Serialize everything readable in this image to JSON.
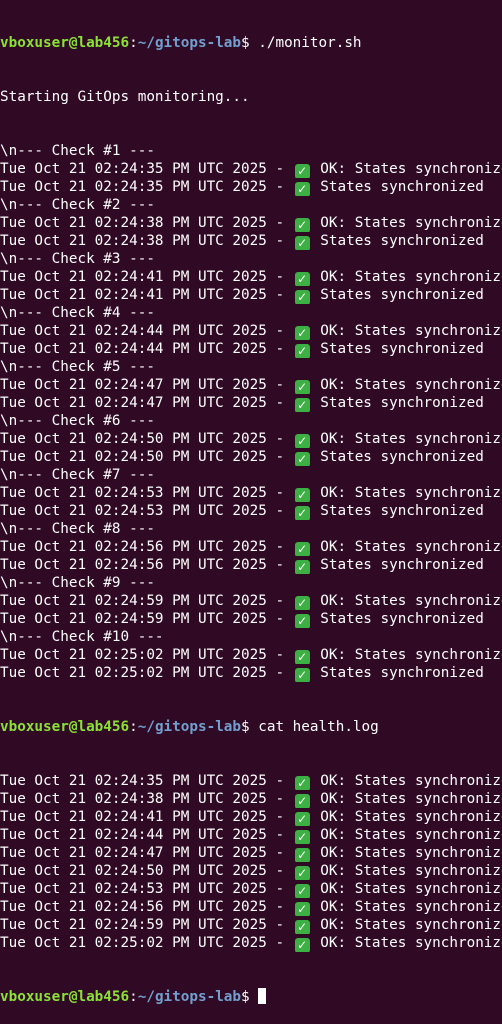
{
  "prompt": {
    "user_host": "vboxuser@lab456",
    "separator": ":",
    "path": "~/gitops-lab",
    "symbol": "$ "
  },
  "commands": {
    "first": "./monitor.sh",
    "second": "cat health.log"
  },
  "monitor_start": "Starting GitOps monitoring...",
  "check_icon_glyph": "✓",
  "checks": [
    {
      "header": "\\n--- Check #1 ---",
      "lines": [
        {
          "prefix": "Tue Oct 21 02:24:35 PM UTC 2025 - ",
          "msg": " OK: States synchronized"
        },
        {
          "prefix": "Tue Oct 21 02:24:35 PM UTC 2025 - ",
          "msg": " States synchronized"
        }
      ]
    },
    {
      "header": "\\n--- Check #2 ---",
      "lines": [
        {
          "prefix": "Tue Oct 21 02:24:38 PM UTC 2025 - ",
          "msg": " OK: States synchronized"
        },
        {
          "prefix": "Tue Oct 21 02:24:38 PM UTC 2025 - ",
          "msg": " States synchronized"
        }
      ]
    },
    {
      "header": "\\n--- Check #3 ---",
      "lines": [
        {
          "prefix": "Tue Oct 21 02:24:41 PM UTC 2025 - ",
          "msg": " OK: States synchronized"
        },
        {
          "prefix": "Tue Oct 21 02:24:41 PM UTC 2025 - ",
          "msg": " States synchronized"
        }
      ]
    },
    {
      "header": "\\n--- Check #4 ---",
      "lines": [
        {
          "prefix": "Tue Oct 21 02:24:44 PM UTC 2025 - ",
          "msg": " OK: States synchronized"
        },
        {
          "prefix": "Tue Oct 21 02:24:44 PM UTC 2025 - ",
          "msg": " States synchronized"
        }
      ]
    },
    {
      "header": "\\n--- Check #5 ---",
      "lines": [
        {
          "prefix": "Tue Oct 21 02:24:47 PM UTC 2025 - ",
          "msg": " OK: States synchronized"
        },
        {
          "prefix": "Tue Oct 21 02:24:47 PM UTC 2025 - ",
          "msg": " States synchronized"
        }
      ]
    },
    {
      "header": "\\n--- Check #6 ---",
      "lines": [
        {
          "prefix": "Tue Oct 21 02:24:50 PM UTC 2025 - ",
          "msg": " OK: States synchronized"
        },
        {
          "prefix": "Tue Oct 21 02:24:50 PM UTC 2025 - ",
          "msg": " States synchronized"
        }
      ]
    },
    {
      "header": "\\n--- Check #7 ---",
      "lines": [
        {
          "prefix": "Tue Oct 21 02:24:53 PM UTC 2025 - ",
          "msg": " OK: States synchronized"
        },
        {
          "prefix": "Tue Oct 21 02:24:53 PM UTC 2025 - ",
          "msg": " States synchronized"
        }
      ]
    },
    {
      "header": "\\n--- Check #8 ---",
      "lines": [
        {
          "prefix": "Tue Oct 21 02:24:56 PM UTC 2025 - ",
          "msg": " OK: States synchronized"
        },
        {
          "prefix": "Tue Oct 21 02:24:56 PM UTC 2025 - ",
          "msg": " States synchronized"
        }
      ]
    },
    {
      "header": "\\n--- Check #9 ---",
      "lines": [
        {
          "prefix": "Tue Oct 21 02:24:59 PM UTC 2025 - ",
          "msg": " OK: States synchronized"
        },
        {
          "prefix": "Tue Oct 21 02:24:59 PM UTC 2025 - ",
          "msg": " States synchronized"
        }
      ]
    },
    {
      "header": "\\n--- Check #10 ---",
      "lines": [
        {
          "prefix": "Tue Oct 21 02:25:02 PM UTC 2025 - ",
          "msg": " OK: States synchronized"
        },
        {
          "prefix": "Tue Oct 21 02:25:02 PM UTC 2025 - ",
          "msg": " States synchronized"
        }
      ]
    }
  ],
  "health_log": [
    {
      "prefix": "Tue Oct 21 02:24:35 PM UTC 2025 - ",
      "msg": " OK: States synchronized"
    },
    {
      "prefix": "Tue Oct 21 02:24:38 PM UTC 2025 - ",
      "msg": " OK: States synchronized"
    },
    {
      "prefix": "Tue Oct 21 02:24:41 PM UTC 2025 - ",
      "msg": " OK: States synchronized"
    },
    {
      "prefix": "Tue Oct 21 02:24:44 PM UTC 2025 - ",
      "msg": " OK: States synchronized"
    },
    {
      "prefix": "Tue Oct 21 02:24:47 PM UTC 2025 - ",
      "msg": " OK: States synchronized"
    },
    {
      "prefix": "Tue Oct 21 02:24:50 PM UTC 2025 - ",
      "msg": " OK: States synchronized"
    },
    {
      "prefix": "Tue Oct 21 02:24:53 PM UTC 2025 - ",
      "msg": " OK: States synchronized"
    },
    {
      "prefix": "Tue Oct 21 02:24:56 PM UTC 2025 - ",
      "msg": " OK: States synchronized"
    },
    {
      "prefix": "Tue Oct 21 02:24:59 PM UTC 2025 - ",
      "msg": " OK: States synchronized"
    },
    {
      "prefix": "Tue Oct 21 02:25:02 PM UTC 2025 - ",
      "msg": " OK: States synchronized"
    }
  ],
  "colors": {
    "background": "#300a24",
    "text": "#ffffff",
    "prompt_user": "#8ae234",
    "prompt_path": "#729fcf",
    "check_icon": "#3cb043"
  }
}
